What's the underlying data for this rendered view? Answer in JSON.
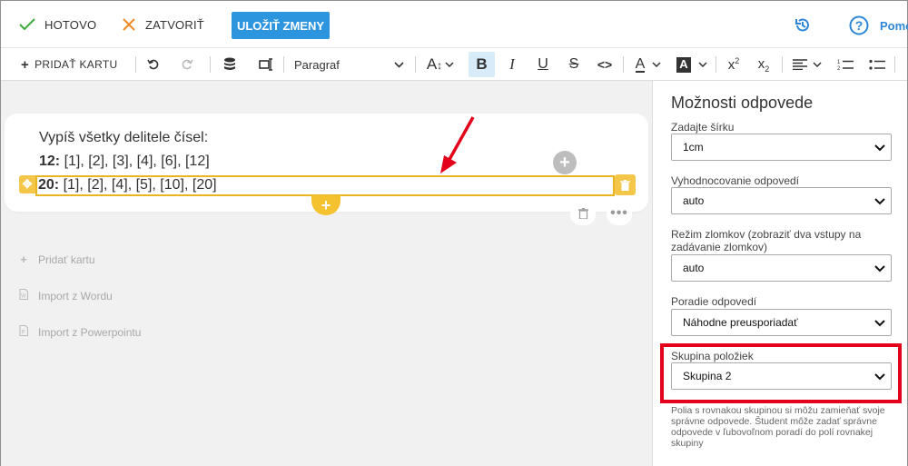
{
  "topbar": {
    "done_label": "HOTOVO",
    "close_label": "ZATVORIŤ",
    "save_label": "ULOŽIŤ ZMENY",
    "help_label": "Pomo"
  },
  "toolbar": {
    "add_card_label": "PRIDAŤ KARTU",
    "paragraph_label": "Paragraf"
  },
  "card": {
    "question": "Vypíš všetky delitele čísel:",
    "row1_number": "12:",
    "row1_values": " [1], [2], [3], [4], [6], [12]",
    "row2_number": "20:",
    "row2_values": " [1], [2], [4], [5], [10], [20]"
  },
  "sidelinks": [
    {
      "label": "Pridať kartu",
      "icon": "plus-icon"
    },
    {
      "label": "Import z Wordu",
      "icon": "word-file-icon"
    },
    {
      "label": "Import z Powerpointu",
      "icon": "powerpoint-file-icon"
    }
  ],
  "panel": {
    "title": "Možnosti odpovede",
    "fields": [
      {
        "label": "Zadajte šírku",
        "value": "1cm"
      },
      {
        "label": "Vyhodnocovanie odpovedí",
        "value": "auto"
      },
      {
        "label": "Režim zlomkov (zobraziť dva vstupy na zadávanie zlomkov)",
        "value": "auto"
      },
      {
        "label": "Poradie odpovedí",
        "value": "Náhodne preusporiadať"
      },
      {
        "label": "Skupina položiek",
        "value": "Skupina 2"
      }
    ],
    "hint": "Polia s rovnakou skupinou si môžu zamieňať svoje správne odpovede. Študent môže zadať správne odpovede v ľubovoľnom poradí do polí rovnakej skupiny"
  },
  "colors": {
    "accent_blue": "#2d95de",
    "highlight_yellow": "#f4c64a",
    "annotation_red": "#e2001a",
    "done_green": "#3caa3c",
    "close_orange": "#f08a24"
  }
}
